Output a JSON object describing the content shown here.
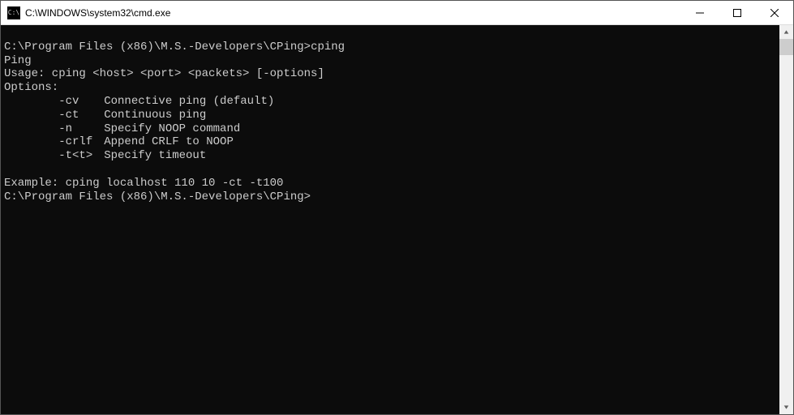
{
  "titlebar": {
    "icon_text": "C:\\",
    "title": "C:\\WINDOWS\\system32\\cmd.exe"
  },
  "terminal": {
    "prompt1": "C:\\Program Files (x86)\\M.S.-Developers\\CPing>",
    "command1": "cping",
    "line_ping": "Ping",
    "line_usage": "Usage: cping <host> <port> <packets> [-options]",
    "line_options_header": "Options:",
    "options": [
      {
        "flag": "-cv",
        "desc": "Connective ping (default)"
      },
      {
        "flag": "-ct",
        "desc": "Continuous ping"
      },
      {
        "flag": "-n",
        "desc": "Specify NOOP command"
      },
      {
        "flag": "-crlf",
        "desc": "Append CRLF to NOOP"
      },
      {
        "flag": "-t<t>",
        "desc": "Specify timeout"
      }
    ],
    "line_example": "Example: cping localhost 110 10 -ct -t100",
    "prompt2": "C:\\Program Files (x86)\\M.S.-Developers\\CPing>"
  }
}
